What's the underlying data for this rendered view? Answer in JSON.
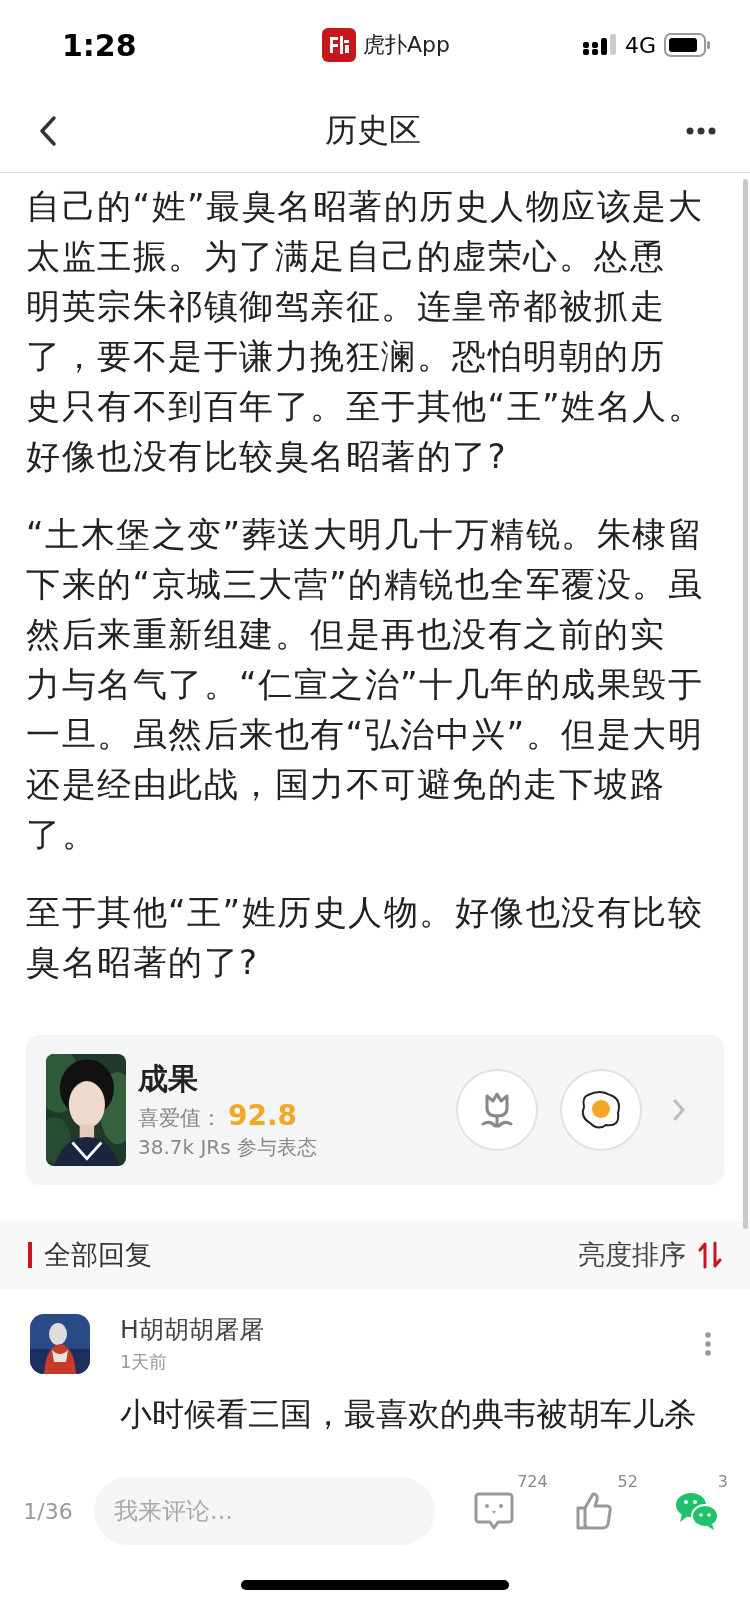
{
  "status_bar": {
    "time": "1:28",
    "app_name": "虎扑App",
    "network": "4G"
  },
  "nav": {
    "title": "历史区"
  },
  "article": {
    "paragraphs": [
      [
        "自己的“姓”最臭名昭著的历史人物应该是大",
        "太监王振。为了满足自己的虚荣心。怂恿",
        "明英宗朱祁镇御驾亲征。连皇帝都被抓走",
        "了，要不是于谦力挽狂澜。恐怕明朝的历",
        "史只有不到百年了。至于其他“王”姓名人。",
        "好像也没有比较臭名昭著的了?"
      ],
      [
        "“土木堡之变”葬送大明几十万精锐。朱棣留",
        "下来的“京城三大营”的精锐也全军覆没。虽",
        "然后来重新组建。但是再也没有之前的实",
        "力与名气了。“仁宣之治”十几年的成果毁于",
        "一旦。虽然后来也有“弘治中兴”。但是大明",
        "还是经由此战，国力不可避免的走下坡路",
        "了。"
      ],
      [
        "至于其他“王”姓历史人物。好像也没有比较",
        "臭名昭著的了?"
      ]
    ]
  },
  "author_card": {
    "name": "成果",
    "score_label": "喜爱值：",
    "score": "92.8",
    "participants": "38.7k JRs 参与表态"
  },
  "replies_header": {
    "title": "全部回复",
    "sort_label": "亮度排序"
  },
  "comments": [
    {
      "user": "H胡胡胡屠屠",
      "time": "1天前",
      "text": "小时候看三国，最喜欢的典韦被胡车儿杀"
    }
  ],
  "bottom_bar": {
    "page": "1/36",
    "placeholder": "我来评论...",
    "comment_count": "724",
    "like_count": "52",
    "share_count": "3"
  }
}
